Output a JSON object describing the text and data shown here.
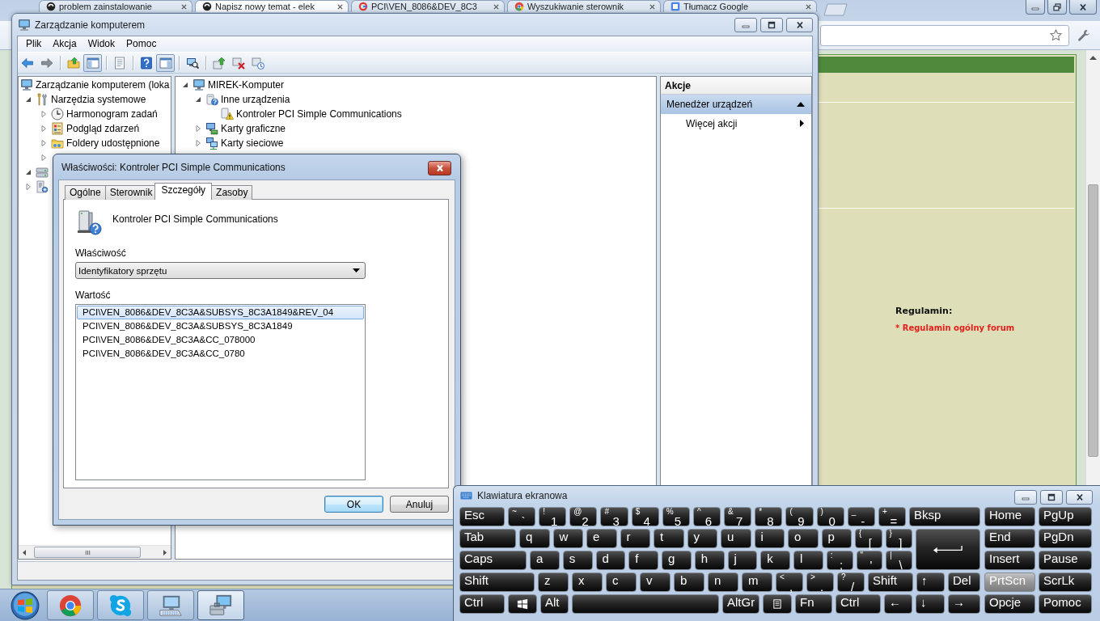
{
  "browser": {
    "tabs": [
      {
        "kind": "disc",
        "title": "problem zainstalowanie",
        "selected": false
      },
      {
        "kind": "disc",
        "title": "Napisz nowy temat - elek",
        "selected": true
      },
      {
        "kind": "ring",
        "title": "PCI\\VEN_8086&DEV_8C3",
        "selected": false
      },
      {
        "kind": "ball",
        "title": "Wyszukiwanie sterownik",
        "selected": false
      },
      {
        "kind": "square",
        "title": "Tłumacz Google",
        "selected": false
      }
    ],
    "page": {
      "rules_heading": "Regulamin:",
      "rules_link": "* Regulamin ogólny forum"
    }
  },
  "management": {
    "title": "Zarządzanie komputerem",
    "menu": [
      "Plik",
      "Akcja",
      "Widok",
      "Pomoc"
    ],
    "toolbar": [
      [
        {
          "kind": "back",
          "pressed": false
        },
        {
          "kind": "forward",
          "pressed": false
        }
      ],
      [
        {
          "kind": "folder-up",
          "pressed": false
        },
        {
          "kind": "tree-pane",
          "pressed": true
        }
      ],
      [
        {
          "kind": "sheet",
          "pressed": false
        }
      ],
      [
        {
          "kind": "help",
          "pressed": false
        },
        {
          "kind": "action-pane",
          "pressed": true
        }
      ],
      [
        {
          "kind": "scan",
          "pressed": false
        }
      ],
      [
        {
          "kind": "update",
          "pressed": false
        },
        {
          "kind": "uninstall",
          "pressed": false
        },
        {
          "kind": "disable",
          "pressed": false
        }
      ]
    ],
    "console_tree": [
      {
        "kind": "computer",
        "label": "Zarządzanie komputerem (loka",
        "children": [
          {
            "kind": "tools",
            "label": "Narzędzia systemowe",
            "expanded": true,
            "children": [
              {
                "kind": "scheduler",
                "label": "Harmonogram zadań",
                "expanded": false
              },
              {
                "kind": "events",
                "label": "Podgląd zdarzeń",
                "expanded": false
              },
              {
                "kind": "shared",
                "label": "Foldery udostępnione",
                "expanded": false
              },
              {
                "expanded": false
              }
            ]
          },
          {
            "kind": "storage",
            "expanded": true
          },
          {
            "kind": "services",
            "expanded": false
          }
        ]
      }
    ],
    "device_tree": [
      {
        "kind": "computer",
        "label": "MIREK-Komputer",
        "expanded": true,
        "children": [
          {
            "kind": "unknown",
            "label": "Inne urządzenia",
            "expanded": true,
            "children": [
              {
                "kind": "warning",
                "label": "Kontroler PCI Simple Communications"
              }
            ]
          },
          {
            "kind": "display",
            "label": "Karty graficzne",
            "expanded": false
          },
          {
            "kind": "network",
            "label": "Karty sieciowe",
            "expanded": false
          }
        ]
      }
    ],
    "actions": {
      "title": "Akcje",
      "sections": [
        {
          "title": "Menedżer urządzeń",
          "expanded": true,
          "items": [
            {
              "label": "Więcej akcji",
              "submenu": true
            }
          ]
        }
      ]
    }
  },
  "properties_dialog": {
    "title": "Właściwości: Kontroler PCI Simple Communications",
    "tabs": [
      {
        "label": "Ogólne",
        "selected": false
      },
      {
        "label": "Sterownik",
        "selected": false
      },
      {
        "label": "Szczegóły",
        "selected": true
      },
      {
        "label": "Zasoby",
        "selected": false
      }
    ],
    "device_name": "Kontroler PCI Simple Communications",
    "property_label": "Właściwość",
    "property": "Identyfikatory sprzętu",
    "value_label": "Wartość",
    "values": [
      {
        "text": "PCI\\VEN_8086&DEV_8C3A&SUBSYS_8C3A1849&REV_04",
        "selected": true
      },
      {
        "text": "PCI\\VEN_8086&DEV_8C3A&SUBSYS_8C3A1849",
        "selected": false
      },
      {
        "text": "PCI\\VEN_8086&DEV_8C3A&CC_078000",
        "selected": false
      },
      {
        "text": "PCI\\VEN_8086&DEV_8C3A&CC_0780",
        "selected": false
      }
    ],
    "buttons": [
      {
        "label": "OK",
        "default": true
      },
      {
        "label": "Anuluj",
        "default": false
      }
    ]
  },
  "on_screen_keyboard": {
    "title": "Klawiatura ekranowa",
    "key_rows": [
      {
        "keys": [
          {
            "kind": "text",
            "label": "Esc"
          },
          {
            "kind": "dual",
            "shift": "~",
            "main": "`"
          },
          {
            "kind": "dual",
            "shift": "!",
            "main": "1"
          },
          {
            "kind": "dual",
            "shift": "@",
            "main": "2"
          },
          {
            "kind": "dual",
            "shift": "#",
            "main": "3"
          },
          {
            "kind": "dual",
            "shift": "$",
            "main": "4"
          },
          {
            "kind": "dual",
            "shift": "%",
            "main": "5"
          },
          {
            "kind": "dual",
            "shift": "^",
            "main": "6"
          },
          {
            "kind": "dual",
            "shift": "&",
            "main": "7"
          },
          {
            "kind": "dual",
            "shift": "*",
            "main": "8"
          },
          {
            "kind": "dual",
            "shift": "(",
            "main": "9"
          },
          {
            "kind": "dual",
            "shift": ")",
            "main": "0"
          },
          {
            "kind": "dual",
            "shift": "_",
            "main": "-"
          },
          {
            "kind": "dual",
            "shift": "+",
            "main": "="
          },
          {
            "kind": "text",
            "label": "Bksp"
          }
        ]
      },
      {
        "keys": [
          {
            "kind": "text",
            "label": "Tab"
          },
          {
            "kind": "char",
            "label": "q"
          },
          {
            "kind": "char",
            "label": "w"
          },
          {
            "kind": "char",
            "label": "e"
          },
          {
            "kind": "char",
            "label": "r"
          },
          {
            "kind": "char",
            "label": "t"
          },
          {
            "kind": "char",
            "label": "y"
          },
          {
            "kind": "char",
            "label": "u"
          },
          {
            "kind": "char",
            "label": "i"
          },
          {
            "kind": "char",
            "label": "o"
          },
          {
            "kind": "char",
            "label": "p"
          },
          {
            "kind": "dual",
            "shift": "{",
            "main": "["
          },
          {
            "kind": "dual",
            "shift": "}",
            "main": "]"
          },
          {
            "kind": "enter"
          }
        ]
      },
      {
        "keys": [
          {
            "kind": "text",
            "label": "Caps"
          },
          {
            "kind": "char",
            "label": "a"
          },
          {
            "kind": "char",
            "label": "s"
          },
          {
            "kind": "char",
            "label": "d"
          },
          {
            "kind": "char",
            "label": "f"
          },
          {
            "kind": "char",
            "label": "g"
          },
          {
            "kind": "char",
            "label": "h"
          },
          {
            "kind": "char",
            "label": "j"
          },
          {
            "kind": "char",
            "label": "k"
          },
          {
            "kind": "char",
            "label": "l"
          },
          {
            "kind": "dual",
            "shift": ":",
            "main": ";"
          },
          {
            "kind": "dual",
            "shift": "\"",
            "main": "'"
          },
          {
            "kind": "dual",
            "shift": "|",
            "main": "\\"
          }
        ]
      },
      {
        "keys": [
          {
            "kind": "text",
            "label": "Shift"
          },
          {
            "kind": "char",
            "label": "z"
          },
          {
            "kind": "char",
            "label": "x"
          },
          {
            "kind": "char",
            "label": "c"
          },
          {
            "kind": "char",
            "label": "v"
          },
          {
            "kind": "char",
            "label": "b"
          },
          {
            "kind": "char",
            "label": "n"
          },
          {
            "kind": "char",
            "label": "m"
          },
          {
            "kind": "dual",
            "shift": "<",
            "main": ","
          },
          {
            "kind": "dual",
            "shift": ">",
            "main": "."
          },
          {
            "kind": "dual",
            "shift": "?",
            "main": "/"
          },
          {
            "kind": "text",
            "label": "Shift"
          },
          {
            "kind": "text",
            "label": "↑"
          },
          {
            "kind": "text",
            "label": "Del"
          }
        ]
      },
      {
        "keys": [
          {
            "kind": "text",
            "label": "Ctrl"
          },
          {
            "kind": "windows"
          },
          {
            "kind": "text",
            "label": "Alt"
          },
          {
            "kind": "space"
          },
          {
            "kind": "text",
            "label": "AltGr"
          },
          {
            "kind": "menu"
          },
          {
            "kind": "text",
            "label": "Fn"
          },
          {
            "kind": "text",
            "label": "Ctrl"
          },
          {
            "kind": "text",
            "label": "←"
          },
          {
            "kind": "text",
            "label": "↓"
          },
          {
            "kind": "text",
            "label": "→"
          }
        ]
      }
    ],
    "nav_keys": [
      {
        "label": "Home",
        "pressed": false
      },
      {
        "label": "PgUp",
        "pressed": false
      },
      {
        "label": "End",
        "pressed": false
      },
      {
        "label": "PgDn",
        "pressed": false
      },
      {
        "label": "Insert",
        "pressed": false
      },
      {
        "label": "Pause",
        "pressed": false
      },
      {
        "label": "PrtScn",
        "pressed": true
      },
      {
        "label": "ScrLk",
        "pressed": false
      },
      {
        "label": "Opcje",
        "pressed": false
      },
      {
        "label": "Pomoc",
        "pressed": false
      }
    ]
  },
  "taskbar": {
    "items": [
      {
        "kind": "start",
        "selected": false
      },
      {
        "kind": "browser",
        "selected": false
      },
      {
        "kind": "messenger",
        "selected": false
      },
      {
        "kind": "keyboard",
        "selected": false
      },
      {
        "kind": "computer-management",
        "selected": true
      }
    ]
  }
}
